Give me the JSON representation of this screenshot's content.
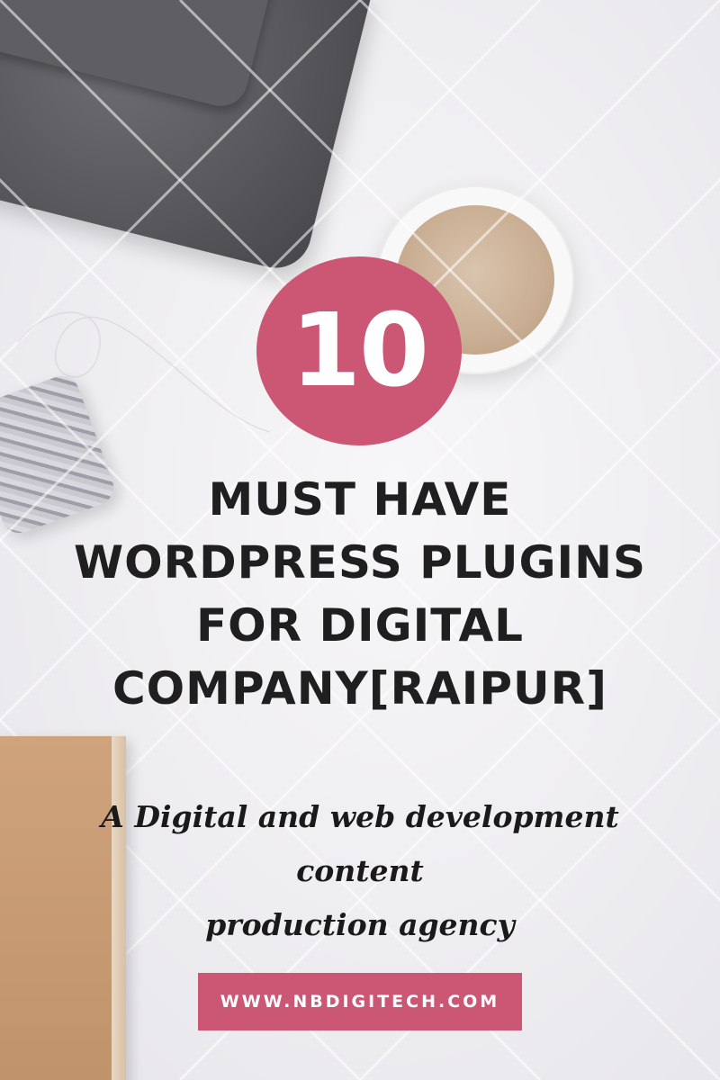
{
  "badge": {
    "number": "10"
  },
  "headline": {
    "lines": [
      "MUST HAVE",
      "WORDPRESS PLUGINS",
      "FOR DIGITAL",
      "COMPANY[RAIPUR]"
    ]
  },
  "tagline": {
    "line1": "A Digital and web development content",
    "line2": "production agency"
  },
  "url_button": {
    "label": "WWW.NBDIGITECH.COM"
  },
  "colors": {
    "accent": "#cc5774",
    "text": "#1f1f1f",
    "background": "#eeedf0"
  },
  "icons": [
    "felt-pouch-image",
    "coffee-cup-image",
    "twine-spool-image",
    "kraft-notebook-image",
    "watermark-grid"
  ]
}
